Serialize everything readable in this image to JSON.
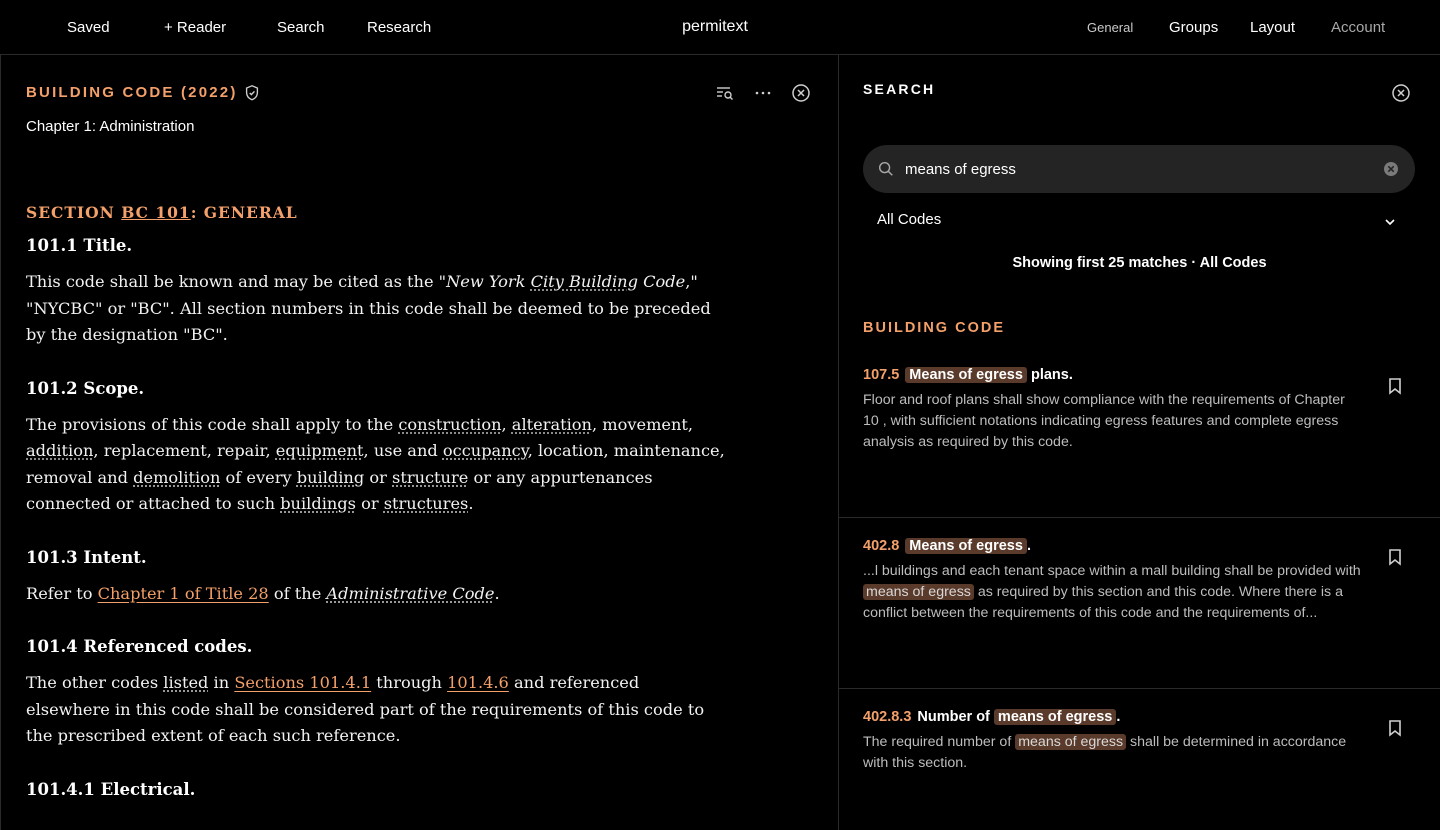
{
  "nav": {
    "saved": "Saved",
    "reader": "+ Reader",
    "search": "Search",
    "research": "Research",
    "brand": "permitext",
    "general": "General",
    "groups": "Groups",
    "layout": "Layout",
    "account": "Account"
  },
  "reader": {
    "title": "BUILDING CODE (2022)",
    "subtitle": "Chapter 1: Administration",
    "section_prefix": "SECTION ",
    "section_code": "BC 101",
    "section_suffix": ": GENERAL",
    "h_101_1": "101.1 Title.",
    "p1_a": "This code shall be known and may be cited as the \"",
    "p1_em1": "New York ",
    "p1_em2": "City Building",
    "p1_em3": " Code",
    "p1_b": ",\" \"NYCBC\" or \"BC\". All section numbers in this code shall be deemed to be preceded by the designation \"BC\".",
    "h_101_2": "101.2 Scope.",
    "p2": {
      "t1": "The provisions of this code shall apply to the ",
      "construction": "construction",
      "t2": ", ",
      "alteration": "alteration",
      "t3": ", movement, ",
      "addition": "addition",
      "t4": ", replacement, repair, ",
      "equipment": "equipment",
      "t5": ", use and ",
      "occupancy": "occupancy",
      "t6": ", location, maintenance, removal and ",
      "demolition": "demolition",
      "t7": " of every ",
      "building": "building",
      "t8": " or ",
      "structure": "structure",
      "t9": " or any appurtenances connected or attached to such ",
      "buildings": "buildings",
      "t10": " or ",
      "structures": "structures",
      "t11": "."
    },
    "h_101_3": "101.3 Intent.",
    "p3": {
      "t1": "Refer to ",
      "link": "Chapter 1 of Title 28",
      "t2": " of the ",
      "em": "Administrative Code",
      "t3": "."
    },
    "h_101_4": "101.4 Referenced codes.",
    "p4": {
      "t1": "The other codes ",
      "listed": "listed",
      "t2": " in ",
      "link1": "Sections 101.4.1",
      "t3": " through ",
      "link2": "101.4.6",
      "t4": " and referenced elsewhere in this code shall be considered part of the requirements of this code to the prescribed extent of each such reference."
    },
    "h_101_4_1": "101.4.1 Electrical."
  },
  "search": {
    "title": "SEARCH",
    "query": "means of egress",
    "filter": "All Codes",
    "matches": "Showing first 25 matches · All Codes",
    "category": "BUILDING CODE",
    "results": [
      {
        "num": "107.5",
        "hl": "Means of egress",
        "tail": " plans.",
        "snip_a": "Floor and roof plans shall show compliance with the requirements of Chapter 10 , with sufficient notations indicating egress features and complete egress analysis as required by this code."
      },
      {
        "num": "402.8",
        "hl": "Means of egress",
        "tail": ".",
        "snip_a": "...l buildings and each tenant space within a mall building shall be provided with ",
        "snip_hl": "means of egress",
        "snip_b": " as required by this section and this code. Where there is a conflict between the requirements of this code and the requirements of..."
      },
      {
        "num": "402.8.3",
        "pre": "Number of ",
        "hl": "means of egress",
        "tail": ".",
        "snip_a": "The required number of ",
        "snip_hl": "means of egress",
        "snip_b": " shall be determined in accordance with this section."
      }
    ]
  },
  "colors": {
    "accent": "#f4a06a",
    "highlight": "#5a3a2a",
    "background": "#000000"
  }
}
